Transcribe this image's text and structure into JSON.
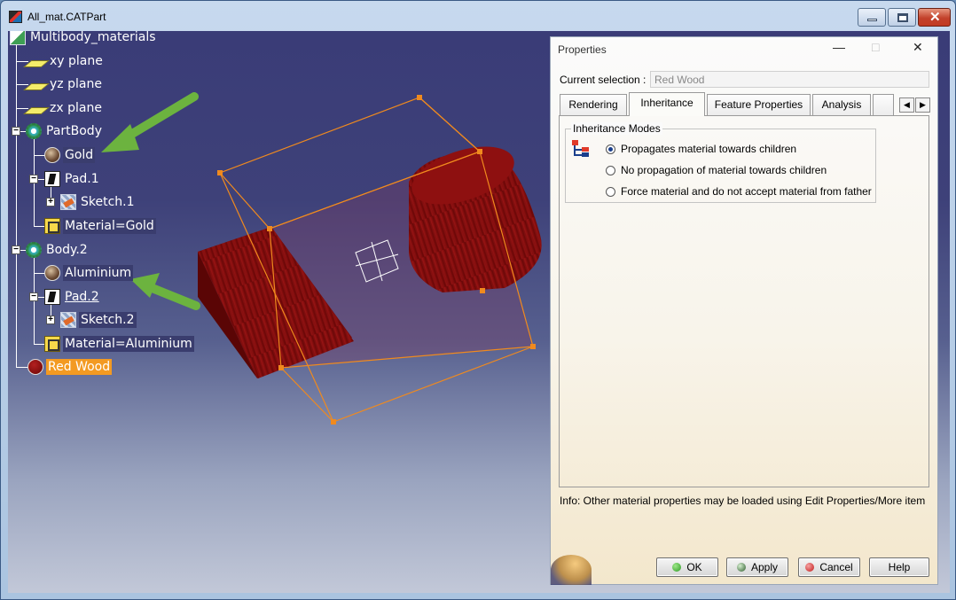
{
  "window": {
    "title": "All_mat.CATPart"
  },
  "tree": {
    "root": "Multibody_materials",
    "nodes": [
      {
        "label": "xy plane"
      },
      {
        "label": "yz plane"
      },
      {
        "label": "zx plane"
      },
      {
        "label": "PartBody"
      },
      {
        "label": "Gold"
      },
      {
        "label": "Pad.1"
      },
      {
        "label": "Sketch.1"
      },
      {
        "label": "Material=Gold"
      },
      {
        "label": "Body.2"
      },
      {
        "label": "Aluminium"
      },
      {
        "label": "Pad.2"
      },
      {
        "label": "Sketch.2"
      },
      {
        "label": "Material=Aluminium"
      },
      {
        "label": "Red Wood"
      }
    ]
  },
  "dialog": {
    "title": "Properties",
    "current_selection_label": "Current selection :",
    "current_selection_value": "Red Wood",
    "tabs": [
      {
        "label": "Rendering"
      },
      {
        "label": "Inheritance"
      },
      {
        "label": "Feature Properties"
      },
      {
        "label": "Analysis"
      }
    ],
    "active_tab": "Inheritance",
    "group_title": "Inheritance Modes",
    "options": [
      {
        "label": "Propagates material towards children",
        "selected": true
      },
      {
        "label": "No propagation of material towards children",
        "selected": false
      },
      {
        "label": "Force material and do not accept material from father",
        "selected": false
      }
    ],
    "info": "Info: Other material properties may be loaded using Edit Properties/More item",
    "buttons": {
      "ok": "OK",
      "apply": "Apply",
      "cancel": "Cancel",
      "help": "Help"
    }
  },
  "colors": {
    "selection_highlight": "#f39a22",
    "bounding_box": "#f08a1e",
    "solid": "#8b0a0a",
    "arrow": "#6cb33f"
  }
}
